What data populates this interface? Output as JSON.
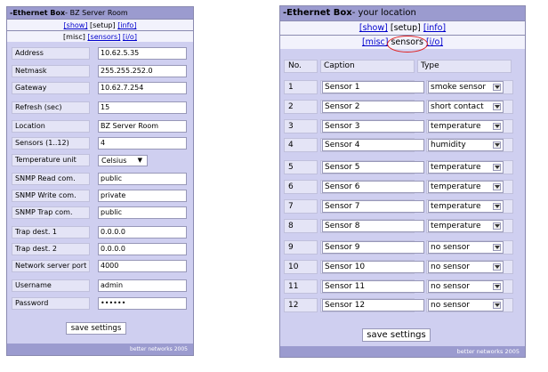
{
  "left": {
    "title": "-Ethernet Box",
    "location": "- BZ Server Room",
    "nav1": {
      "show": "[show]",
      "setup": "[setup]",
      "info": "[info]"
    },
    "nav2": {
      "misc": "[misc]",
      "sensors": "[sensors]",
      "io": "[i/o]"
    },
    "fields": [
      {
        "label": "Address",
        "value": "10.62.5.35"
      },
      {
        "label": "Netmask",
        "value": "255.255.252.0"
      },
      {
        "label": "Gateway",
        "value": "10.62.7.254"
      },
      {
        "label": "Refresh (sec)",
        "value": "15"
      },
      {
        "label": "Location",
        "value": "BZ Server Room"
      },
      {
        "label": "Sensors (1..12)",
        "value": "4"
      },
      {
        "label": "Temperature unit",
        "value": "Celsius"
      },
      {
        "label": "SNMP Read com.",
        "value": "public"
      },
      {
        "label": "SNMP Write com.",
        "value": "private"
      },
      {
        "label": "SNMP Trap com.",
        "value": "public"
      },
      {
        "label": "Trap dest. 1",
        "value": "0.0.0.0"
      },
      {
        "label": "Trap dest. 2",
        "value": "0.0.0.0"
      },
      {
        "label": "Network server port",
        "value": "4000"
      },
      {
        "label": "Username",
        "value": "admin"
      },
      {
        "label": "Password",
        "value": "••••••"
      }
    ],
    "save": "save settings",
    "footer": "better networks 2005"
  },
  "right": {
    "title": "-Ethernet Box",
    "location": "- your location",
    "nav1": {
      "show": "[show]",
      "setup": "[setup]",
      "info": "[info]"
    },
    "nav2": {
      "misc": "[misc]",
      "sensors": "sensors",
      "io": "[i/o]"
    },
    "headers": {
      "no": "No.",
      "caption": "Caption",
      "type": "Type"
    },
    "rows": [
      {
        "no": "1",
        "caption": "Sensor 1",
        "type": "smoke sensor"
      },
      {
        "no": "2",
        "caption": "Sensor 2",
        "type": "short contact"
      },
      {
        "no": "3",
        "caption": "Sensor 3",
        "type": "temperature"
      },
      {
        "no": "4",
        "caption": "Sensor 4",
        "type": "humidity"
      },
      {
        "no": "5",
        "caption": "Sensor 5",
        "type": "temperature"
      },
      {
        "no": "6",
        "caption": "Sensor 6",
        "type": "temperature"
      },
      {
        "no": "7",
        "caption": "Sensor 7",
        "type": "temperature"
      },
      {
        "no": "8",
        "caption": "Sensor 8",
        "type": "temperature"
      },
      {
        "no": "9",
        "caption": "Sensor 9",
        "type": "no sensor"
      },
      {
        "no": "10",
        "caption": "Sensor 10",
        "type": "no sensor"
      },
      {
        "no": "11",
        "caption": "Sensor 11",
        "type": "no sensor"
      },
      {
        "no": "12",
        "caption": "Sensor 12",
        "type": "no sensor"
      }
    ],
    "save": "save settings",
    "footer": "better networks 2005"
  },
  "colors": {
    "panel": "#cfcff0",
    "title_bar": "#9b9bcf",
    "annotation": "#e02020"
  }
}
